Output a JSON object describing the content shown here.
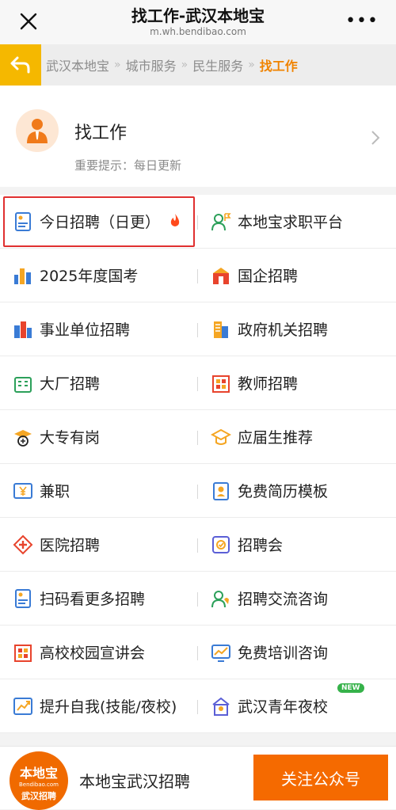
{
  "topbar": {
    "title": "找工作-武汉本地宝",
    "url": "m.wh.bendibao.com",
    "close_icon": "close-icon",
    "more_icon": "more-icon"
  },
  "breadcrumb": {
    "items": [
      "武汉本地宝",
      "城市服务",
      "民生服务",
      "找工作"
    ],
    "separator": "»"
  },
  "header": {
    "title": "找工作",
    "tip": "重要提示：每日更新"
  },
  "grid": [
    {
      "left": {
        "label": "今日招聘（日更）",
        "icon": "resume-icon",
        "highlight": true,
        "fire": true
      },
      "right": {
        "label": "本地宝求职平台",
        "icon": "user-flag-icon"
      }
    },
    {
      "left": {
        "label": "2025年度国考",
        "icon": "city-buildings-icon"
      },
      "right": {
        "label": "国企招聘",
        "icon": "state-enterprise-icon"
      }
    },
    {
      "left": {
        "label": "事业单位招聘",
        "icon": "institution-icon"
      },
      "right": {
        "label": "政府机关招聘",
        "icon": "government-building-icon"
      }
    },
    {
      "left": {
        "label": "大厂招聘",
        "icon": "office-building-icon"
      },
      "right": {
        "label": "教师招聘",
        "icon": "school-icon"
      }
    },
    {
      "left": {
        "label": "大专有岗",
        "icon": "graduate-hat-icon"
      },
      "right": {
        "label": "应届生推荐",
        "icon": "mortarboard-icon"
      }
    },
    {
      "left": {
        "label": "兼职",
        "icon": "yen-screen-icon"
      },
      "right": {
        "label": "免费简历模板",
        "icon": "id-badge-icon"
      }
    },
    {
      "left": {
        "label": "医院招聘",
        "icon": "medical-cross-icon"
      },
      "right": {
        "label": "招聘会",
        "icon": "check-shield-icon"
      }
    },
    {
      "left": {
        "label": "扫码看更多招聘",
        "icon": "resume-icon"
      },
      "right": {
        "label": "招聘交流咨询",
        "icon": "user-chat-icon"
      }
    },
    {
      "left": {
        "label": "高校校园宣讲会",
        "icon": "campus-icon"
      },
      "right": {
        "label": "免费培训咨询",
        "icon": "chart-board-icon"
      }
    },
    {
      "left": {
        "label": "提升自我(技能/夜校)",
        "icon": "growth-chart-icon"
      },
      "right": {
        "label": "武汉青年夜校",
        "icon": "night-school-icon",
        "badge": "NEW"
      }
    }
  ],
  "footer": {
    "logo_line1": "本地宝",
    "logo_line2": "Bendibao.com",
    "logo_line3": "武汉招聘",
    "name": "本地宝武汉招聘",
    "follow_label": "关注公众号"
  },
  "colors": {
    "accent": "#f56a00",
    "breadcrumb_current": "#f08300",
    "back_button": "#f5b800",
    "highlight_border": "#e03030"
  }
}
